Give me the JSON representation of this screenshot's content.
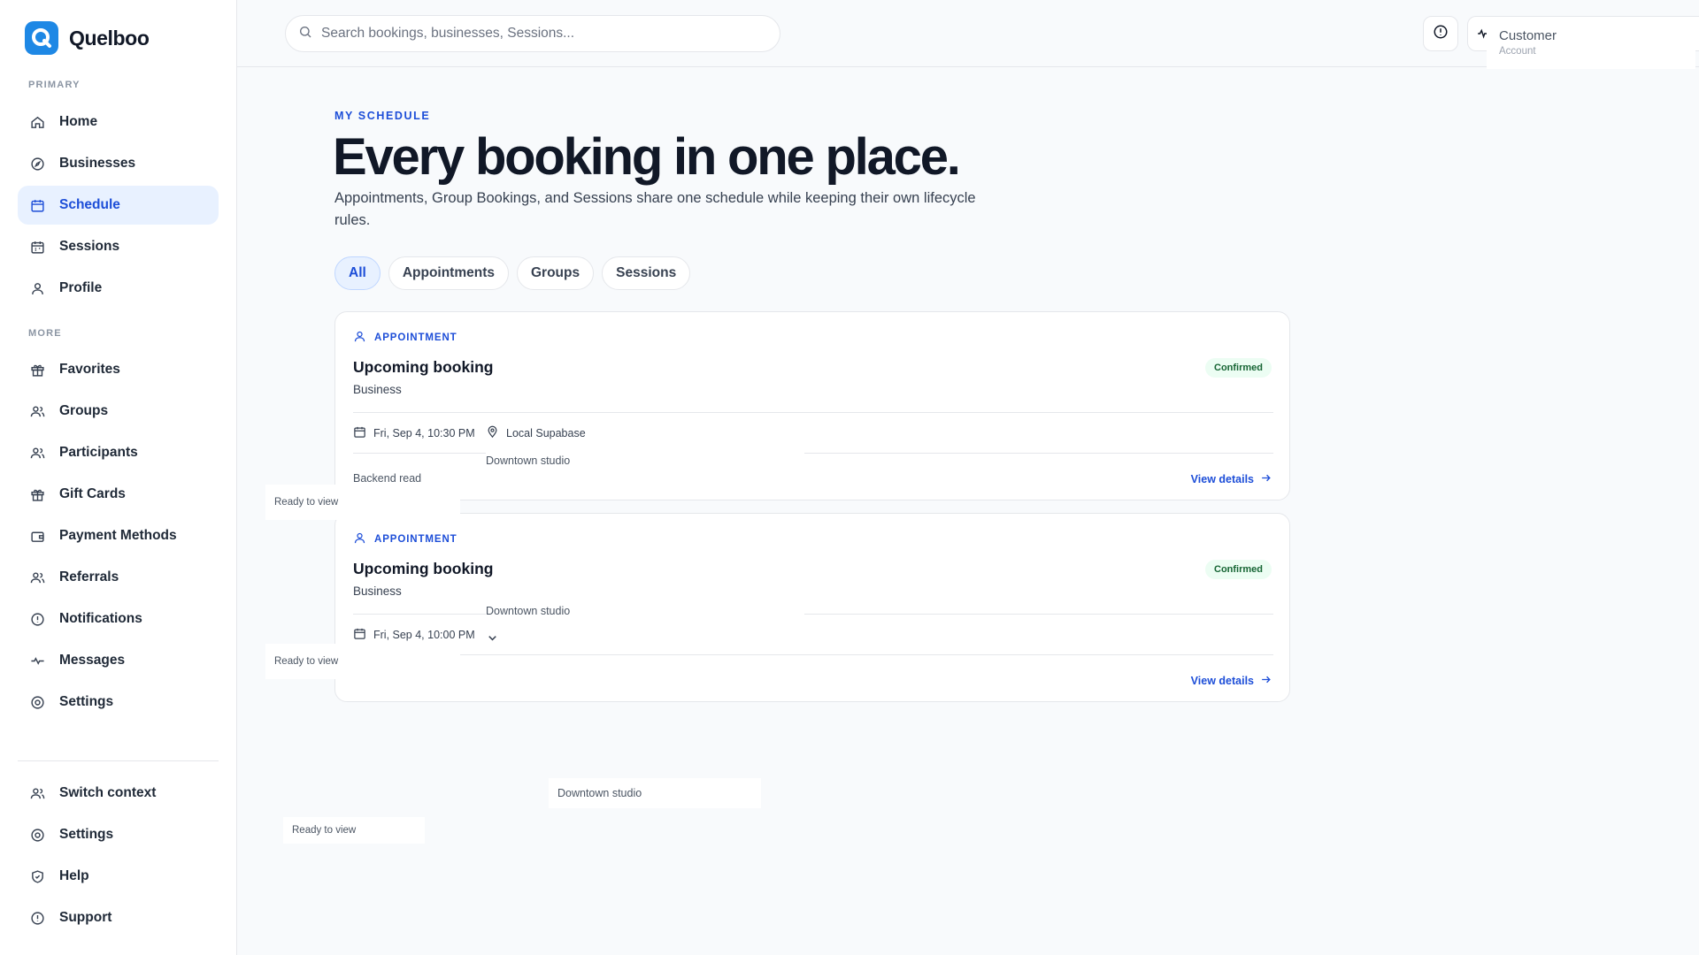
{
  "app": {
    "name": "Quelboo"
  },
  "colors": {
    "accent": "#1d4ed8",
    "brand": "#1e88e5",
    "success": "#166534"
  },
  "sidebar": {
    "primary_label": "PRIMARY",
    "more_label": "MORE",
    "primary": [
      {
        "label": "Home",
        "icon": "home-icon"
      },
      {
        "label": "Businesses",
        "icon": "compass-icon"
      },
      {
        "label": "Schedule",
        "icon": "calendar-icon",
        "active": true
      },
      {
        "label": "Sessions",
        "icon": "calendar-check-icon"
      },
      {
        "label": "Profile",
        "icon": "user-icon"
      }
    ],
    "more": [
      {
        "label": "Favorites",
        "icon": "gift-icon"
      },
      {
        "label": "Groups",
        "icon": "users-icon"
      },
      {
        "label": "Participants",
        "icon": "users-icon"
      },
      {
        "label": "Gift Cards",
        "icon": "gift-icon"
      },
      {
        "label": "Payment Methods",
        "icon": "wallet-icon"
      },
      {
        "label": "Referrals",
        "icon": "users-icon"
      },
      {
        "label": "Notifications",
        "icon": "alert-circle-icon"
      },
      {
        "label": "Messages",
        "icon": "activity-icon"
      },
      {
        "label": "Settings",
        "icon": "settings-icon"
      }
    ],
    "footer": [
      {
        "label": "Switch context",
        "icon": "users-icon"
      },
      {
        "label": "Settings",
        "icon": "settings-icon"
      },
      {
        "label": "Help",
        "icon": "shield-icon"
      },
      {
        "label": "Support",
        "icon": "alert-circle-icon"
      }
    ]
  },
  "search": {
    "placeholder": "Search bookings, businesses, Sessions..."
  },
  "account": {
    "title": "Customer",
    "subtitle": "Account"
  },
  "main": {
    "eyebrow": "MY SCHEDULE",
    "headline": "Every booking in one place.",
    "subtitle": "Appointments, Group Bookings, and Sessions share one schedule while keeping their own lifecycle rules.",
    "filters": [
      {
        "label": "All",
        "active": true
      },
      {
        "label": "Appointments"
      },
      {
        "label": "Groups"
      },
      {
        "label": "Sessions"
      }
    ],
    "bookings": [
      {
        "kind": "APPOINTMENT",
        "title": "Upcoming booking",
        "business": "Business",
        "status": "Confirmed",
        "datetime": "Fri, Sep 4, 10:30 PM",
        "location": "Local Supabase",
        "studio": "Downtown studio",
        "source": "Backend read",
        "action": "View details"
      },
      {
        "kind": "APPOINTMENT",
        "title": "Upcoming booking",
        "business": "Business",
        "status": "Confirmed",
        "datetime": "Fri, Sep 4, 10:00 PM",
        "studio": "Downtown studio",
        "action": "View details"
      }
    ]
  },
  "floating": {
    "ready_1": "Ready to view",
    "ready_2": "Ready to view",
    "ready_3": "Ready to view",
    "studio_3": "Downtown studio"
  }
}
